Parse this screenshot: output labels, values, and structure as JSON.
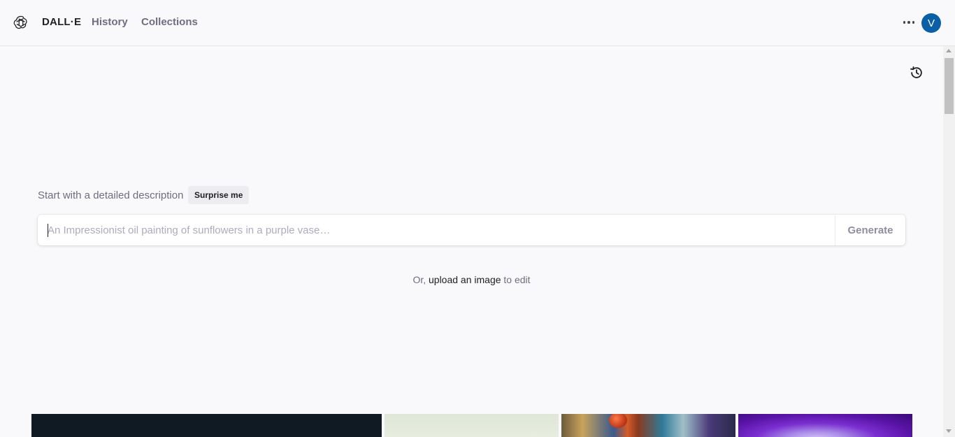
{
  "header": {
    "brand": "DALL·E",
    "nav": [
      "History",
      "Collections"
    ],
    "user_initial": "V"
  },
  "prompt": {
    "intro": "Start with a detailed description",
    "surprise_label": "Surprise me",
    "placeholder": "An Impressionist oil painting of sunflowers in a purple vase…",
    "value": "",
    "generate_label": "Generate"
  },
  "upload": {
    "prefix": "Or,",
    "link_label": "upload an image",
    "suffix": "to edit"
  },
  "icons": {
    "logo": "openai-logo-icon",
    "more": "more-horizontal-icon",
    "history": "history-icon"
  },
  "colors": {
    "accent_avatar": "#0b5fa5",
    "background": "#f9f9fb"
  }
}
